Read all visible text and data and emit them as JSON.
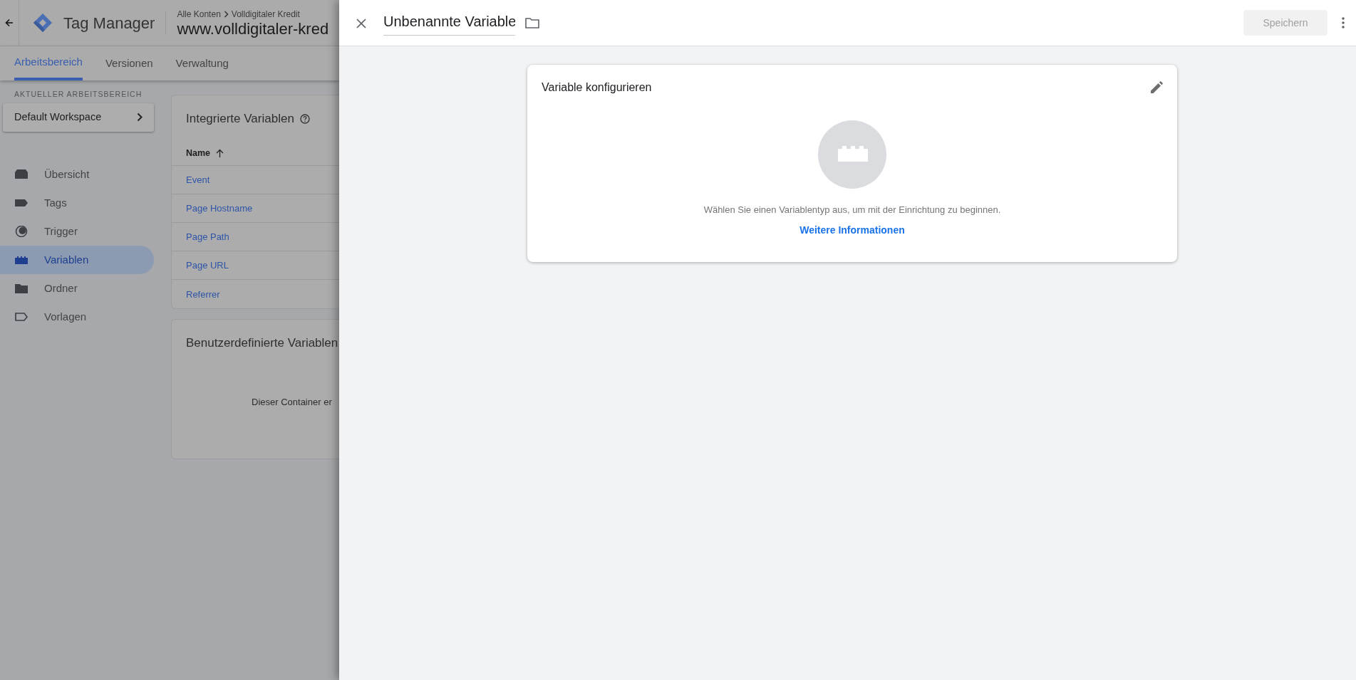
{
  "header": {
    "app_title": "Tag Manager",
    "breadcrumb": [
      "Alle Konten",
      "Volldigitaler Kredit"
    ],
    "container_name": "www.volldigitaler-kred"
  },
  "tabs": [
    {
      "label": "Arbeitsbereich",
      "selected": true
    },
    {
      "label": "Versionen",
      "selected": false
    },
    {
      "label": "Verwaltung",
      "selected": false
    }
  ],
  "workspace": {
    "heading": "AKTUELLER ARBEITSBEREICH",
    "name": "Default Workspace"
  },
  "sidebar": {
    "items": [
      {
        "label": "Übersicht",
        "kind": "overview",
        "selected": false
      },
      {
        "label": "Tags",
        "kind": "tag",
        "selected": false
      },
      {
        "label": "Trigger",
        "kind": "trigger",
        "selected": false
      },
      {
        "label": "Variablen",
        "kind": "variable",
        "selected": true
      },
      {
        "label": "Ordner",
        "kind": "folder",
        "selected": false
      },
      {
        "label": "Vorlagen",
        "kind": "template",
        "selected": false
      }
    ]
  },
  "builtin_variables": {
    "title": "Integrierte Variablen",
    "column": "Name",
    "rows": [
      "Event",
      "Page Hostname",
      "Page Path",
      "Page URL",
      "Referrer"
    ]
  },
  "custom_variables": {
    "title": "Benutzerdefinierte Variablen",
    "empty_text": "Dieser Container er"
  },
  "panel": {
    "title": "Unbenannte Variable",
    "save_label": "Speichern",
    "save_disabled": true,
    "config": {
      "title": "Variable konfigurieren",
      "hint": "Wählen Sie einen Variablentyp aus, um mit der Einrichtung zu beginnen.",
      "link": "Weitere Informationen"
    }
  }
}
